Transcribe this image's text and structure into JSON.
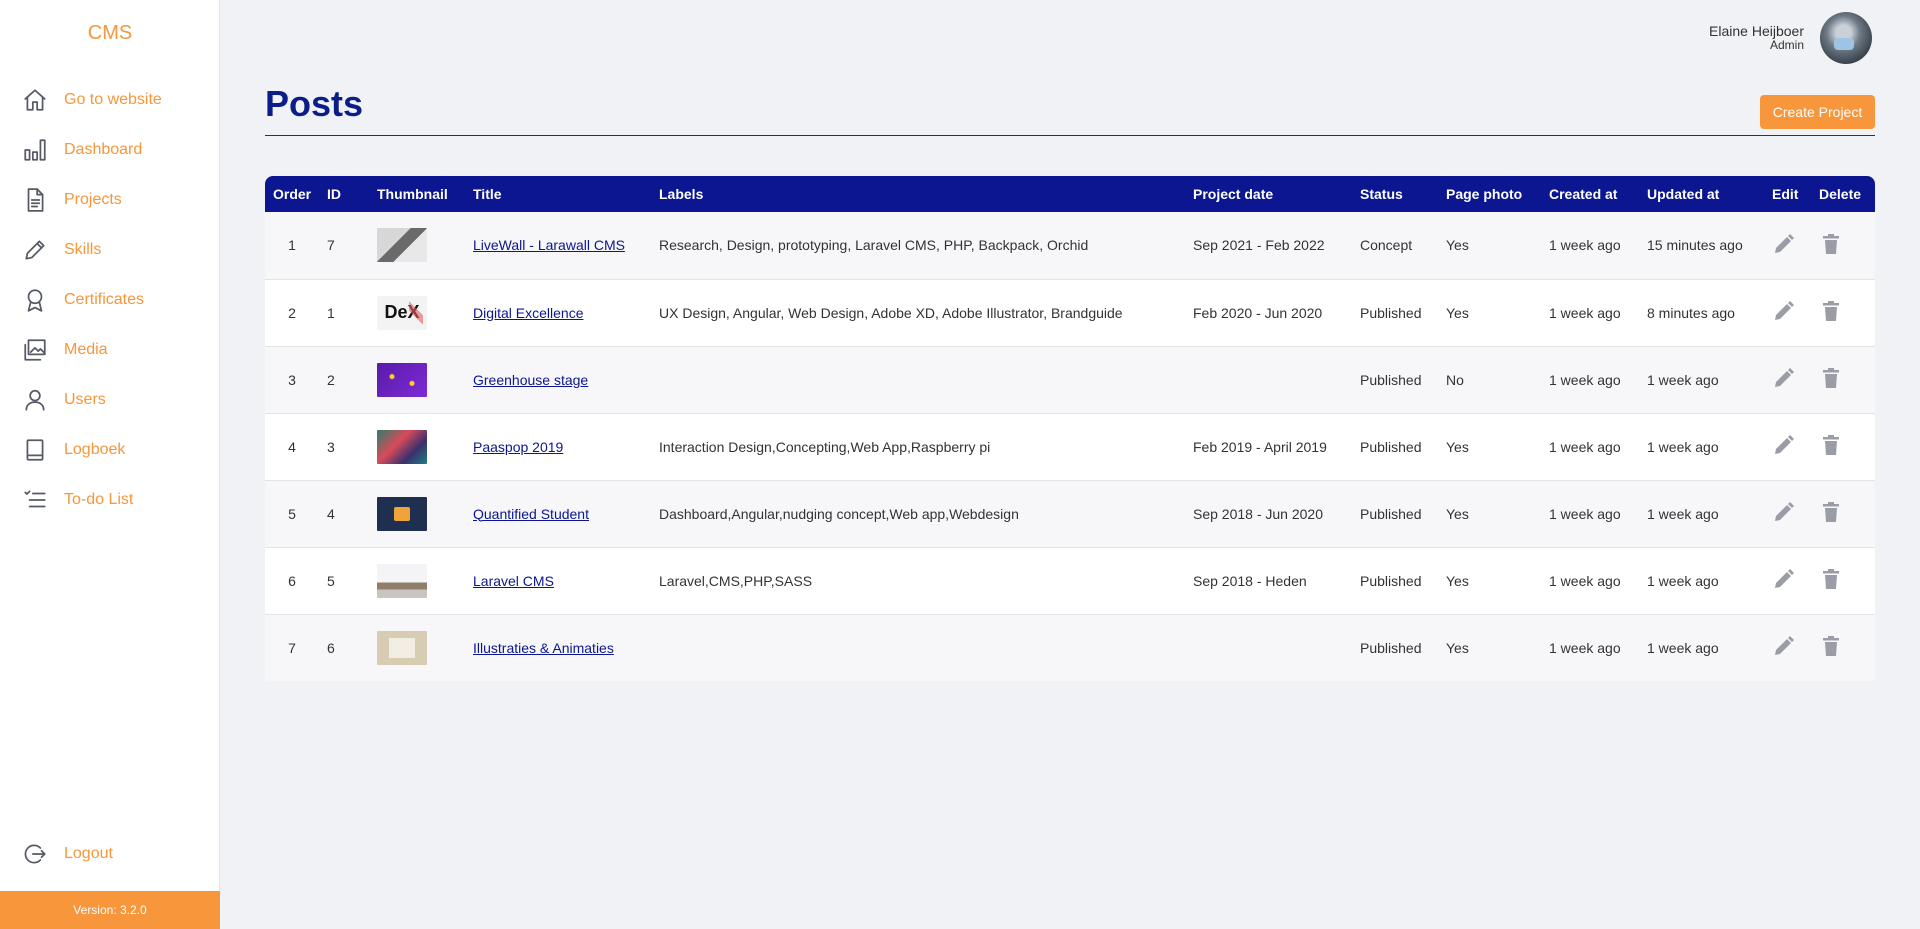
{
  "sidebar": {
    "brand": "CMS",
    "items": [
      {
        "label": "Go to website",
        "icon": "home-icon"
      },
      {
        "label": "Dashboard",
        "icon": "bar-chart-icon"
      },
      {
        "label": "Projects",
        "icon": "document-icon"
      },
      {
        "label": "Skills",
        "icon": "pencil-icon"
      },
      {
        "label": "Certificates",
        "icon": "award-icon"
      },
      {
        "label": "Media",
        "icon": "images-icon"
      },
      {
        "label": "Users",
        "icon": "user-icon"
      },
      {
        "label": "Logboek",
        "icon": "notebook-icon"
      },
      {
        "label": "To-do List",
        "icon": "checklist-icon"
      }
    ],
    "logout": {
      "label": "Logout",
      "icon": "logout-icon"
    },
    "version": "Version: 3.2.0"
  },
  "user": {
    "name": "Elaine Heijboer",
    "role": "Admin"
  },
  "page": {
    "title": "Posts",
    "create_button": "Create Project"
  },
  "table": {
    "headers": [
      "Order",
      "ID",
      "Thumbnail",
      "Title",
      "Labels",
      "Project date",
      "Status",
      "Page photo",
      "Created at",
      "Updated at",
      "Edit",
      "Delete"
    ],
    "rows": [
      {
        "order": "1",
        "id": "7",
        "title": "LiveWall - Larawall CMS",
        "labels": "Research, Design, prototyping, Laravel CMS, PHP, Backpack, Orchid",
        "project_date": "Sep 2021 - Feb 2022",
        "status": "Concept",
        "page_photo": "Yes",
        "created_at": "1 week ago",
        "updated_at": "15 minutes ago"
      },
      {
        "order": "2",
        "id": "1",
        "title": "Digital Excellence",
        "thumb_text": "DeX",
        "labels": "UX Design, Angular, Web Design, Adobe XD, Adobe Illustrator, Brandguide",
        "project_date": "Feb 2020 - Jun 2020",
        "status": "Published",
        "page_photo": "Yes",
        "created_at": "1 week ago",
        "updated_at": "8 minutes ago"
      },
      {
        "order": "3",
        "id": "2",
        "title": "Greenhouse stage",
        "labels": "",
        "project_date": "",
        "status": "Published",
        "page_photo": "No",
        "created_at": "1 week ago",
        "updated_at": "1 week ago"
      },
      {
        "order": "4",
        "id": "3",
        "title": "Paaspop 2019",
        "labels": "Interaction Design,Concepting,Web App,Raspberry pi",
        "project_date": "Feb 2019 - April 2019",
        "status": "Published",
        "page_photo": "Yes",
        "created_at": "1 week ago",
        "updated_at": "1 week ago"
      },
      {
        "order": "5",
        "id": "4",
        "title": "Quantified Student",
        "labels": "Dashboard,Angular,nudging concept,Web app,Webdesign",
        "project_date": "Sep 2018 - Jun 2020",
        "status": "Published",
        "page_photo": "Yes",
        "created_at": "1 week ago",
        "updated_at": "1 week ago"
      },
      {
        "order": "6",
        "id": "5",
        "title": "Laravel CMS",
        "labels": "Laravel,CMS,PHP,SASS",
        "project_date": "Sep 2018 - Heden",
        "status": "Published",
        "page_photo": "Yes",
        "created_at": "1 week ago",
        "updated_at": "1 week ago"
      },
      {
        "order": "7",
        "id": "6",
        "title": "Illustraties & Animaties",
        "labels": "",
        "project_date": "",
        "status": "Published",
        "page_photo": "Yes",
        "created_at": "1 week ago",
        "updated_at": "1 week ago"
      }
    ]
  },
  "colors": {
    "accent": "#f7963a",
    "primary": "#0b1690",
    "title": "#0b1d88"
  }
}
